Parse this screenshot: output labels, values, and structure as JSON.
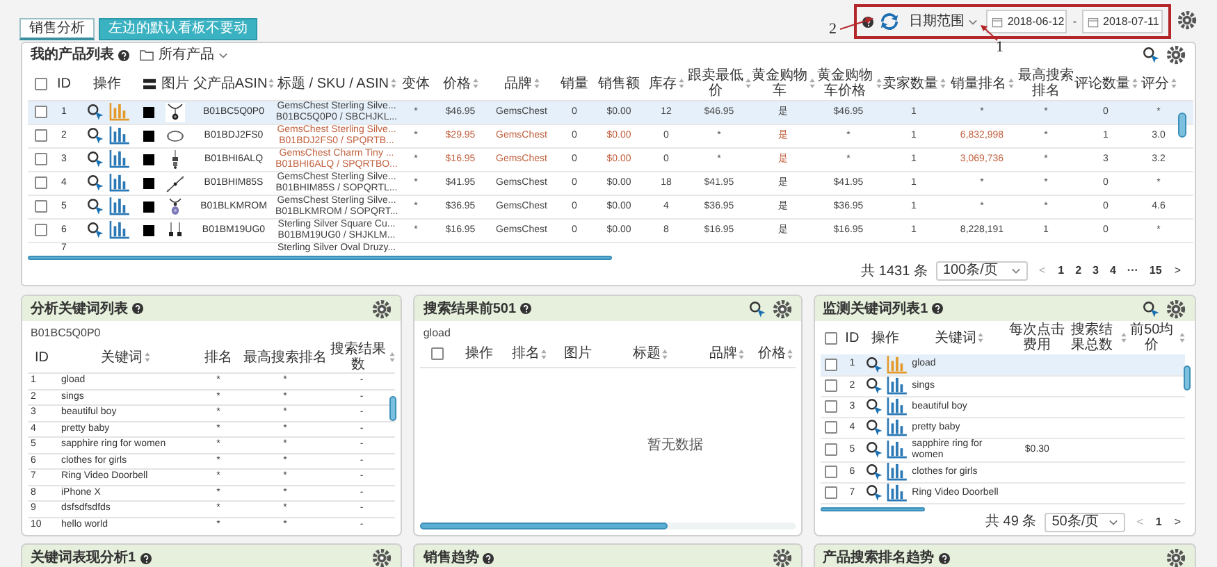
{
  "tabs": [
    {
      "label": "销售分析",
      "selected": true
    },
    {
      "label": "左边的默认看板不要动",
      "selected": false
    }
  ],
  "toolbar": {
    "date_range": "日期范围",
    "start_date": "2018-06-12",
    "separator": "-",
    "end_date": "2018-07-11"
  },
  "annotations": [
    {
      "label": "2"
    },
    {
      "label": "1"
    }
  ],
  "product_list": {
    "title": "我的产品列表",
    "filter": "所有产品",
    "columns": [
      {
        "kind": "checkbox",
        "checked": false
      },
      {
        "label": "ID"
      },
      {
        "label": "操作"
      },
      {
        "kind": "icon"
      },
      {
        "label": "图片"
      },
      {
        "label": "父产品ASIN",
        "sortable": true
      },
      {
        "label": "标题 / SKU / ASIN",
        "sortable": true
      },
      {
        "label": "变体"
      },
      {
        "label": "价格",
        "sortable": true
      },
      {
        "label": "品牌",
        "sortable": true
      },
      {
        "label": "销量"
      },
      {
        "label": "销售额"
      },
      {
        "label": "库存",
        "sortable": true
      },
      {
        "label": "跟卖最低价",
        "sortable": true
      },
      {
        "label": "黄金购物车",
        "sortable": true
      },
      {
        "label": "黄金购物车价格",
        "sortable": true
      },
      {
        "label": "卖家数量",
        "sortable": true
      },
      {
        "label": "销量排名",
        "sortable": true
      },
      {
        "label": "最高搜索排名"
      },
      {
        "label": "评论数量",
        "sortable": true
      },
      {
        "label": "评分",
        "sortable": true
      }
    ],
    "rows": [
      {
        "id": "1",
        "selected": true,
        "alert": false,
        "checked": false,
        "parent_asin": "B01BC5Q0P0",
        "title": "GemsChest Sterling Silve...",
        "sku_line": "B01BC5Q0P0 / SBCHJKL...",
        "values": [
          "*",
          "$46.95",
          "GemsChest",
          "0",
          "$0.00",
          "12",
          "$46.95",
          "是",
          "$46.95",
          "1",
          "*",
          "*",
          "0",
          "*"
        ]
      },
      {
        "id": "2",
        "selected": false,
        "alert": true,
        "checked": false,
        "parent_asin": "B01BDJ2FS0",
        "title": "GemsChest Sterling Silve...",
        "sku_line": "B01BDJ2FS0 / SPQRTB...",
        "values": [
          "*",
          "$29.95",
          "GemsChest",
          "0",
          "$0.00",
          "0",
          "*",
          "是",
          "*",
          "1",
          "6,832,998",
          "*",
          "1",
          "3.0"
        ]
      },
      {
        "id": "3",
        "selected": false,
        "alert": true,
        "checked": false,
        "parent_asin": "B01BHI6ALQ",
        "title": "GemsChest Charm Tiny ...",
        "sku_line": "B01BHI6ALQ / SPQRTBO...",
        "values": [
          "*",
          "$16.95",
          "GemsChest",
          "0",
          "$0.00",
          "0",
          "*",
          "是",
          "*",
          "1",
          "3,069,736",
          "*",
          "3",
          "3.2"
        ]
      },
      {
        "id": "4",
        "selected": false,
        "alert": false,
        "checked": false,
        "parent_asin": "B01BHIM85S",
        "title": "GemsChest Sterling Silve...",
        "sku_line": "B01BHIM85S / SOPQRTL...",
        "values": [
          "*",
          "$41.95",
          "GemsChest",
          "0",
          "$0.00",
          "18",
          "$41.95",
          "是",
          "$41.95",
          "1",
          "*",
          "*",
          "0",
          "*"
        ]
      },
      {
        "id": "5",
        "selected": false,
        "alert": false,
        "checked": false,
        "parent_asin": "B01BLKMROM",
        "title": "GemsChest Sterling Silve...",
        "sku_line": "B01BLKMROM / SOPQRT...",
        "values": [
          "*",
          "$36.95",
          "GemsChest",
          "0",
          "$0.00",
          "4",
          "$36.95",
          "是",
          "$36.95",
          "1",
          "*",
          "*",
          "0",
          "4.6"
        ]
      },
      {
        "id": "6",
        "selected": false,
        "alert": false,
        "checked": false,
        "parent_asin": "B01BM19UG0",
        "title": "Sterling Silver Square Cu...",
        "sku_line": "B01BM19UG0 / SHJKLM...",
        "values": [
          "*",
          "$16.95",
          "GemsChest",
          "0",
          "$0.00",
          "8",
          "$16.95",
          "是",
          "$16.95",
          "1",
          "8,228,191",
          "1",
          "0",
          "*"
        ]
      }
    ],
    "partial_row": {
      "id": "7",
      "title": "Sterling Silver Oval Druzy..."
    },
    "total": "共 1431 条",
    "page_size": "100条/页",
    "prev": "<",
    "pages": [
      "1",
      "2",
      "3",
      "4",
      "···",
      "15"
    ],
    "next": ">"
  },
  "keyword_analysis": {
    "title": "分析关键词列表",
    "asin": "B01BC5Q0P0",
    "columns": [
      {
        "label": "ID"
      },
      {
        "label": "关键词",
        "sortable": true
      },
      {
        "label": "排名"
      },
      {
        "label": "最高搜索排名"
      },
      {
        "label": "搜索结果数",
        "sortable": true
      }
    ],
    "rows": [
      {
        "id": "1",
        "keyword": "gload",
        "rank": "*",
        "top_rank": "*",
        "results": "-"
      },
      {
        "id": "2",
        "keyword": "sings",
        "rank": "*",
        "top_rank": "*",
        "results": "-"
      },
      {
        "id": "3",
        "keyword": "beautiful boy",
        "rank": "*",
        "top_rank": "*",
        "results": "-"
      },
      {
        "id": "4",
        "keyword": "pretty baby",
        "rank": "*",
        "top_rank": "*",
        "results": "-"
      },
      {
        "id": "5",
        "keyword": "sapphire ring for women",
        "rank": "*",
        "top_rank": "*",
        "results": "-"
      },
      {
        "id": "6",
        "keyword": "clothes for girls",
        "rank": "*",
        "top_rank": "*",
        "results": "-"
      },
      {
        "id": "7",
        "keyword": "Ring Video Doorbell",
        "rank": "*",
        "top_rank": "*",
        "results": "-"
      },
      {
        "id": "8",
        "keyword": "iPhone X",
        "rank": "*",
        "top_rank": "*",
        "results": "-"
      },
      {
        "id": "9",
        "keyword": "dsfsdfsdfds",
        "rank": "*",
        "top_rank": "*",
        "results": "-"
      },
      {
        "id": "10",
        "keyword": "hello world",
        "rank": "*",
        "top_rank": "*",
        "results": "-"
      }
    ]
  },
  "search_results": {
    "title": "搜索结果前501",
    "keyword": "gload",
    "columns": [
      {
        "kind": "checkbox",
        "checked": false
      },
      {
        "label": "操作"
      },
      {
        "label": "排名",
        "sortable": true
      },
      {
        "label": "图片"
      },
      {
        "label": "标题",
        "sortable": true
      },
      {
        "label": "品牌",
        "sortable": true
      },
      {
        "label": "价格",
        "sortable": true
      }
    ],
    "empty_text": "暂无数据"
  },
  "monitored_keywords": {
    "title": "监测关键词列表1",
    "columns": [
      {
        "kind": "checkbox",
        "checked": false
      },
      {
        "label": "ID"
      },
      {
        "label": "操作"
      },
      {
        "label": "关键词",
        "sortable": true
      },
      {
        "label": "每次点击费用"
      },
      {
        "label": "搜索结果总数",
        "sortable": true
      },
      {
        "label": "前50均价",
        "sortable": true
      }
    ],
    "rows": [
      {
        "id": "1",
        "keyword": "gload",
        "checked": false,
        "selected": true
      },
      {
        "id": "2",
        "keyword": "sings",
        "checked": false,
        "selected": false
      },
      {
        "id": "3",
        "keyword": "beautiful boy",
        "checked": false,
        "selected": false
      },
      {
        "id": "4",
        "keyword": "pretty baby",
        "checked": false,
        "selected": false
      },
      {
        "id": "5",
        "keyword": "sapphire ring for women",
        "cpc": "$0.30",
        "checked": false,
        "selected": false
      },
      {
        "id": "6",
        "keyword": "clothes for girls",
        "checked": false,
        "selected": false
      },
      {
        "id": "7",
        "keyword": "Ring Video Doorbell",
        "checked": false,
        "selected": false
      }
    ],
    "total": "共 49 条",
    "page_size": "50条/页",
    "prev": "<",
    "page": "1",
    "next": ">"
  },
  "lower_panels": [
    {
      "title": "关键词表现分析1"
    },
    {
      "title": "销售趋势"
    },
    {
      "title": "产品搜索排名趋势"
    }
  ]
}
